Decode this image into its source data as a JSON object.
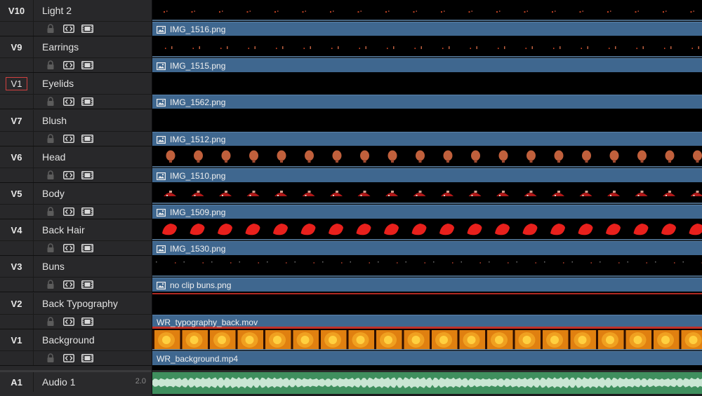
{
  "tracks": [
    {
      "id": "V10",
      "name": "Light 2",
      "clip": "IMG_1516.png",
      "clip_icon": "image-icon",
      "frame_style": "dots-light",
      "active": false
    },
    {
      "id": "V9",
      "name": "Earrings",
      "clip": "IMG_1515.png",
      "clip_icon": "image-icon",
      "frame_style": "dots-earrings",
      "active": false
    },
    {
      "id": "V1",
      "name": "Eyelids",
      "clip": "IMG_1562.png",
      "clip_icon": "image-icon",
      "frame_style": "empty",
      "active": true
    },
    {
      "id": "V7",
      "name": "Blush",
      "clip": "IMG_1512.png",
      "clip_icon": "image-icon",
      "frame_style": "empty",
      "active": false
    },
    {
      "id": "V6",
      "name": "Head",
      "clip": "IMG_1510.png",
      "clip_icon": "image-icon",
      "frame_style": "head",
      "active": false
    },
    {
      "id": "V5",
      "name": "Body",
      "clip": "IMG_1509.png",
      "clip_icon": "image-icon",
      "frame_style": "body",
      "active": false
    },
    {
      "id": "V4",
      "name": "Back Hair",
      "clip": "IMG_1530.png",
      "clip_icon": "image-icon",
      "frame_style": "hair",
      "active": false
    },
    {
      "id": "V3",
      "name": "Buns",
      "clip": "no clip buns.png",
      "clip_icon": "image-icon",
      "frame_style": "dots-buns",
      "active": false
    },
    {
      "id": "V2",
      "name": "Back Typography",
      "clip": "WR_typography_back.mov",
      "clip_icon": "",
      "frame_style": "typography",
      "active": false
    },
    {
      "id": "V1",
      "name": "Background",
      "clip": "WR_background.mp4",
      "clip_icon": "",
      "frame_style": "background",
      "active": false
    }
  ],
  "audio": {
    "id": "A1",
    "name": "Audio 1",
    "gain": "2.0"
  },
  "icons": {
    "lock": "lock-icon",
    "auto_select": "auto-select-icon",
    "track_enable": "film-strip-icon"
  },
  "colors": {
    "clip_blue": "#3f678f",
    "selection_red": "#d04040",
    "head_brown": "#c0603c",
    "hair_red": "#e8201c",
    "audio_green": "#3f8f5e"
  }
}
